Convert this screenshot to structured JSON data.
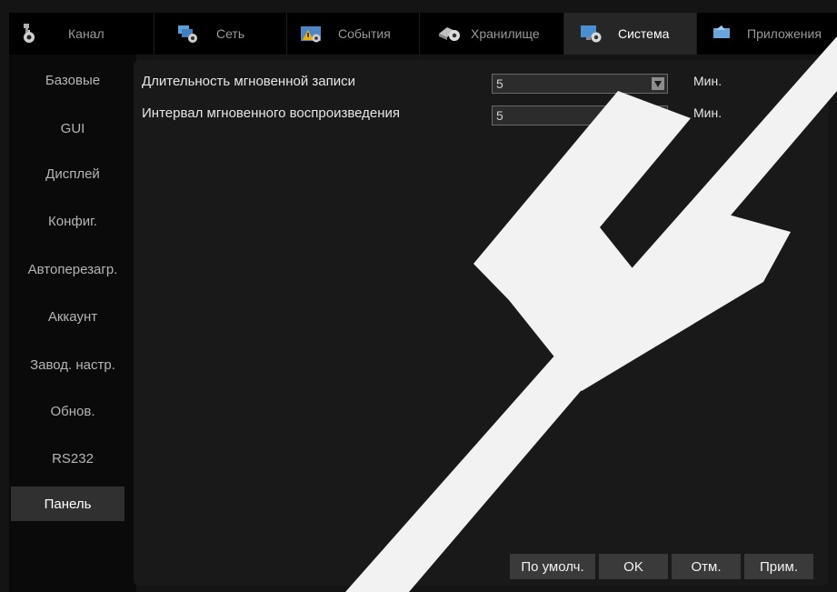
{
  "tabs": [
    {
      "label": "Канал",
      "icon": "camera-gear-icon",
      "active": false
    },
    {
      "label": "Сеть",
      "icon": "network-gear-icon",
      "active": false
    },
    {
      "label": "События",
      "icon": "warning-gear-icon",
      "active": false
    },
    {
      "label": "Хранилище",
      "icon": "storage-gear-icon",
      "active": false
    },
    {
      "label": "Система",
      "icon": "monitor-gear-icon",
      "active": true
    },
    {
      "label": "Приложения",
      "icon": "app-icon",
      "active": false
    }
  ],
  "sidebar": {
    "items": [
      {
        "label": "Базовые"
      },
      {
        "label": "GUI"
      },
      {
        "label": "Дисплей"
      },
      {
        "label": "Конфиг."
      },
      {
        "label": "Автоперезагр."
      },
      {
        "label": "Аккаунт"
      },
      {
        "label": "Завод. настр."
      },
      {
        "label": "Обнов."
      },
      {
        "label": "RS232"
      },
      {
        "label": "Панель",
        "active": true
      }
    ]
  },
  "settings": [
    {
      "label": "Длительность мгновенной записи",
      "value": "5",
      "unit": "Мин."
    },
    {
      "label": "Интервал мгновенного воспроизведения",
      "value": "5",
      "unit": "Мин."
    }
  ],
  "buttons": {
    "default": "По умолч.",
    "ok": "OK",
    "cancel": "Отм.",
    "apply": "Прим."
  },
  "colors": {
    "background": "#141414",
    "tab_bar": "#000000",
    "active_tab": "#262626",
    "panel": "#191919",
    "active_sidebar": "#303030",
    "button": "#3a3a3a",
    "watermark": "#f2f2f2"
  }
}
